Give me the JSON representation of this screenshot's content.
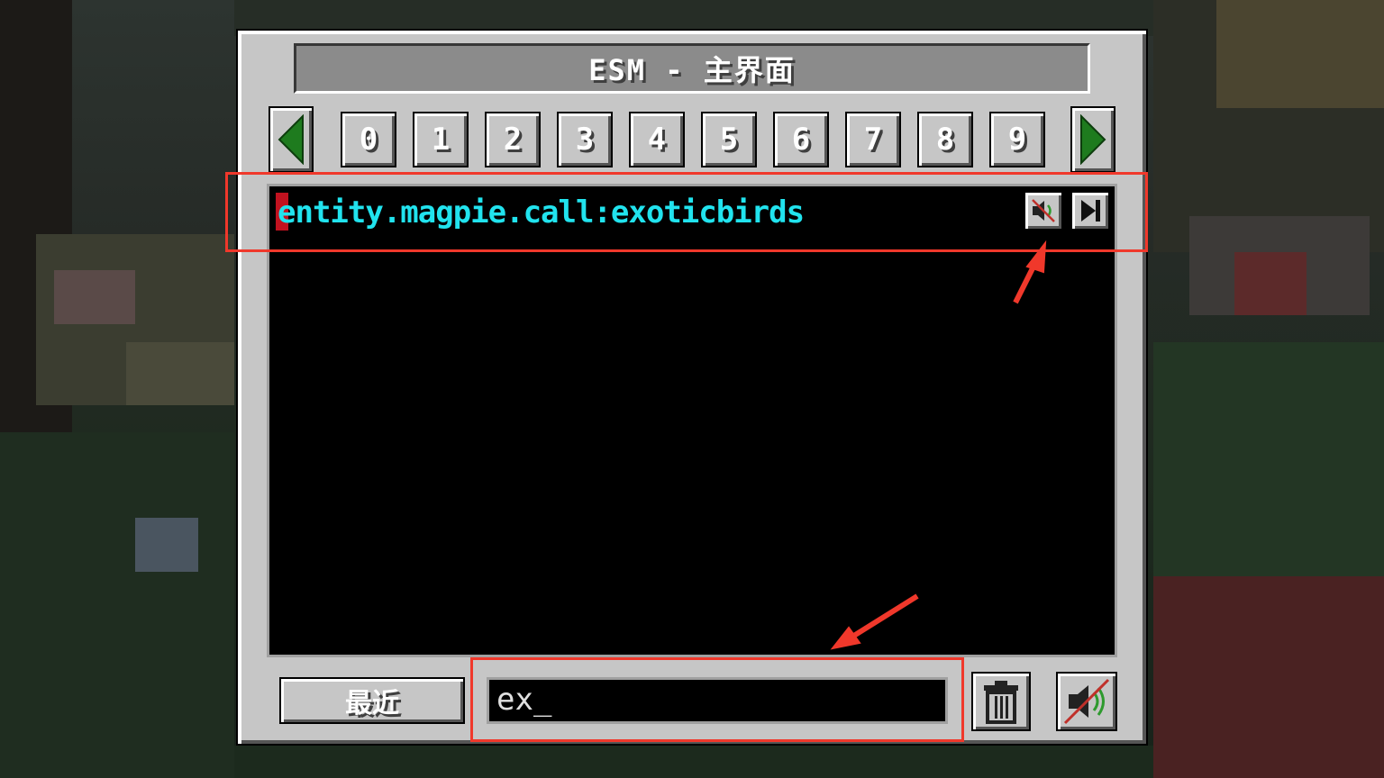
{
  "dialog": {
    "title": "ESM - 主界面",
    "prev_page_icon": "left-arrow-icon",
    "next_page_icon": "right-arrow-icon",
    "pages": [
      "0",
      "1",
      "2",
      "3",
      "4",
      "5",
      "6",
      "7",
      "8",
      "9"
    ]
  },
  "sound_list": {
    "items": [
      {
        "name": "entity.magpie.call:exoticbirds",
        "mute_icon": "speaker-muted-icon",
        "play_icon": "play-next-icon"
      }
    ]
  },
  "footer": {
    "recent_label": "最近",
    "search_value": "ex_",
    "trash_icon": "trash-icon",
    "mute_all_icon": "speaker-muted-icon"
  },
  "colors": {
    "panel": "#c6c6c6",
    "entry_text": "#21e3ee",
    "annotation": "#f0382b",
    "arrow_green": "#1e7b1e"
  }
}
